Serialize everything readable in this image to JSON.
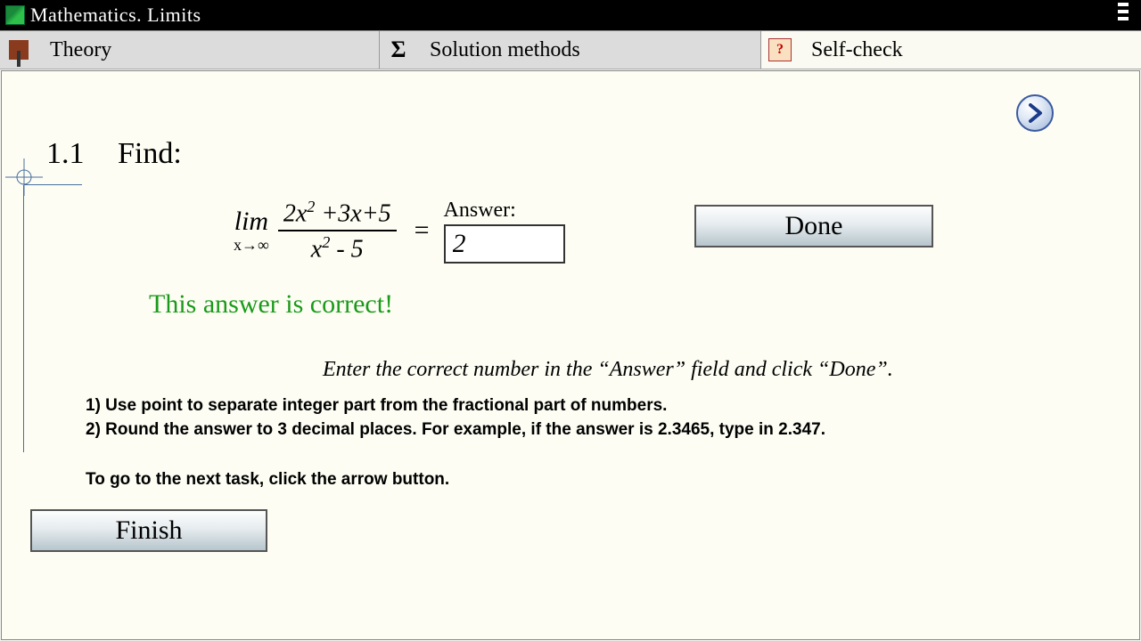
{
  "titlebar": {
    "text": "Mathematics. Limits"
  },
  "tabs": {
    "theory": "Theory",
    "methods": "Solution methods",
    "selfcheck": "Self-check"
  },
  "task": {
    "number": "1.1",
    "title": "Find:",
    "limit": {
      "word": "lim",
      "sub": "x→∞",
      "numerator_html": "2x<sup>2</sup> +3x+5",
      "denominator_html": "x<sup>2</sup> - 5"
    },
    "equals": "=",
    "answer_label": "Answer:",
    "answer_value": "2"
  },
  "buttons": {
    "done": "Done",
    "finish": "Finish"
  },
  "feedback": "This answer is correct!",
  "instruction": "Enter the correct number in the “Answer” field and click “Done”.",
  "hints": {
    "h1": "1) Use point to separate integer part from the fractional part of numbers.",
    "h2": "2) Round the answer to 3 decimal places. For example, if the answer is 2.3465, type in 2.347.",
    "h3": "To go to the next task, click the arrow button."
  },
  "icons": {
    "sigma": "Σ",
    "selfcheck_mark": "?"
  }
}
